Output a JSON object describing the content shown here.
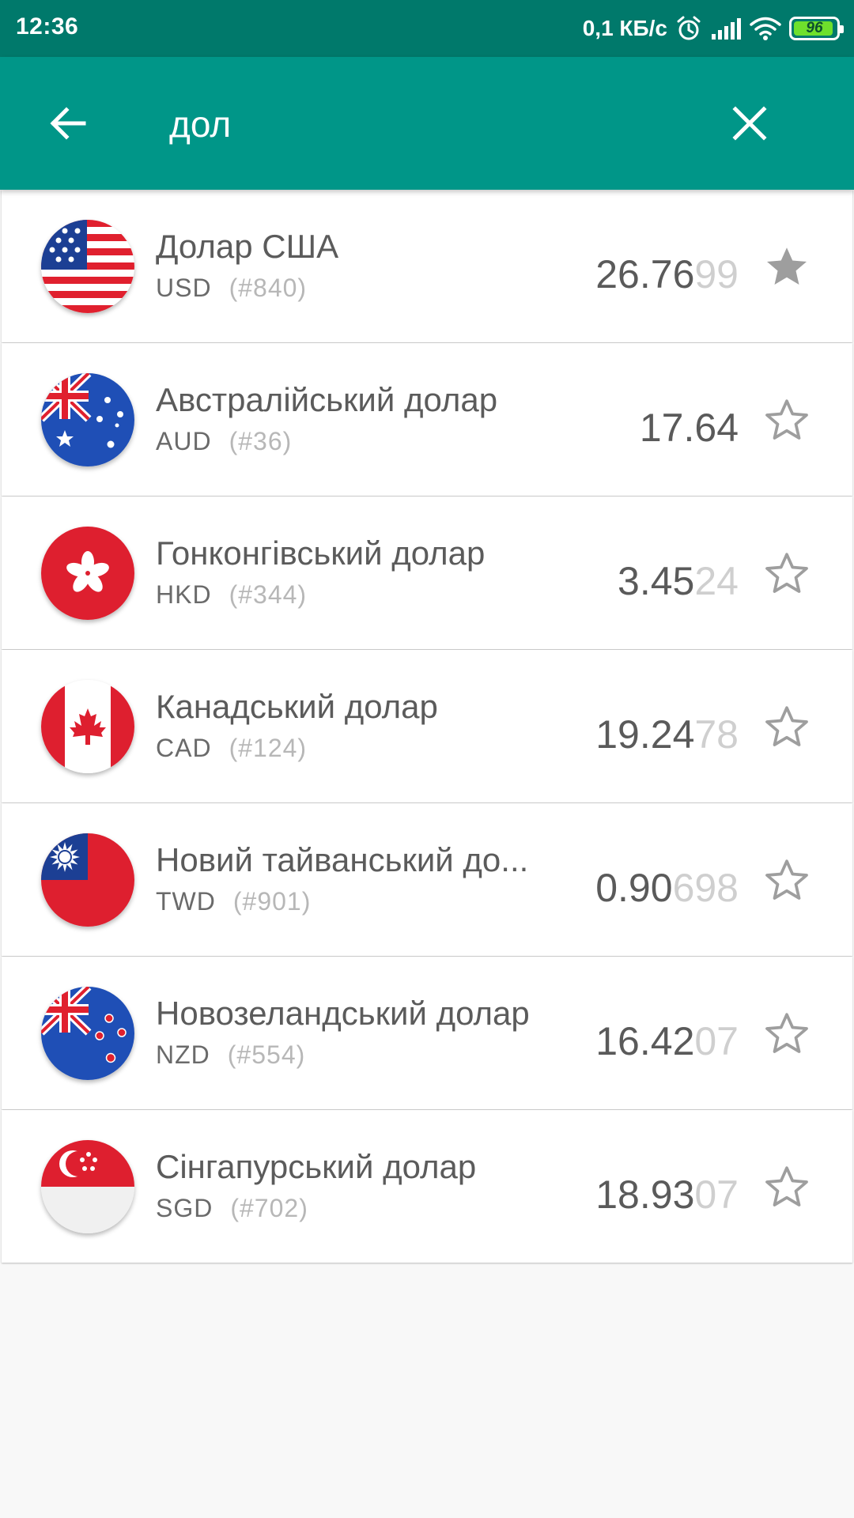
{
  "status_bar": {
    "time": "12:36",
    "network_speed": "0,1 КБ/с",
    "battery_level": "96",
    "icons": [
      "alarm-icon",
      "signal-icon",
      "wifi-icon",
      "battery-icon"
    ]
  },
  "app_bar": {
    "back_icon": "arrow-left-icon",
    "search_value": "дол",
    "clear_icon": "close-icon"
  },
  "colors": {
    "status_bar": "#00796b",
    "app_bar": "#009688",
    "background": "#f8f8f8",
    "card": "#ffffff"
  },
  "currencies": [
    {
      "name": "Долар США",
      "code": "USD",
      "num": "(#840)",
      "rate_main": "26.76",
      "rate_tail": "99",
      "favorite": true,
      "flag": "us-flag-icon"
    },
    {
      "name": "Австралійський долар",
      "code": "AUD",
      "num": "(#36)",
      "rate_main": "17.64",
      "rate_tail": "",
      "favorite": false,
      "flag": "au-flag-icon"
    },
    {
      "name": "Гонконгівський долар",
      "code": "HKD",
      "num": "(#344)",
      "rate_main": "3.45",
      "rate_tail": "24",
      "favorite": false,
      "flag": "hk-flag-icon"
    },
    {
      "name": "Канадський долар",
      "code": "CAD",
      "num": "(#124)",
      "rate_main": "19.24",
      "rate_tail": "78",
      "favorite": false,
      "flag": "ca-flag-icon"
    },
    {
      "name": "Новий тайванський до...",
      "code": "TWD",
      "num": "(#901)",
      "rate_main": "0.90",
      "rate_tail": "698",
      "favorite": false,
      "flag": "tw-flag-icon"
    },
    {
      "name": "Новозеландський долар",
      "code": "NZD",
      "num": "(#554)",
      "rate_main": "16.42",
      "rate_tail": "07",
      "favorite": false,
      "flag": "nz-flag-icon"
    },
    {
      "name": "Сінгапурський долар",
      "code": "SGD",
      "num": "(#702)",
      "rate_main": "18.93",
      "rate_tail": "07",
      "favorite": false,
      "flag": "sg-flag-icon"
    }
  ]
}
